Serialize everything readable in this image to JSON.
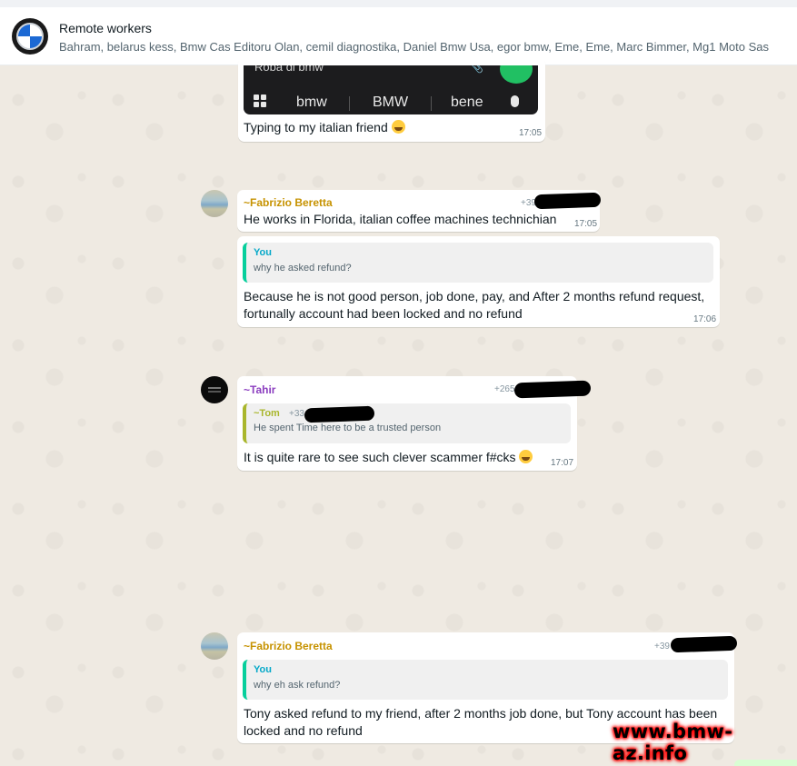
{
  "header": {
    "group_name": "Remote workers",
    "members": "Bahram, belarus kess, Bmw Cas Editoru Olan, cemil diagnostika, Daniel Bmw Usa, egor bmw, Eme, Eme, Marc Bimmer, Mg1 Moto Sas"
  },
  "messages": [
    {
      "keyboard_input": "Roba di bmw",
      "suggestions": [
        "bmw",
        "BMW",
        "bene"
      ],
      "text": "Typing to my italian friend",
      "emoji": "tears-of-joy-emoji",
      "time": "17:05"
    },
    {
      "sender": "~Fabrizio Beretta",
      "sender_color": "#c69200",
      "phone_prefix": "+39",
      "text": "He works in Florida, italian coffee machines technichian",
      "time": "17:05"
    },
    {
      "quote_name": "You",
      "quote_color": "#06cf9c",
      "quote_text": "why he asked refund?",
      "text_line1": "Because he is not good person, job done, pay, and After 2 months refund request,",
      "text_line2": "fortunally account had been locked and no refund",
      "time": "17:06"
    },
    {
      "sender": "~Tahir",
      "sender_color": "#8b3dbf",
      "phone_prefix": "+265",
      "quote_name": "~Tom",
      "quote_color": "#a9b62c",
      "quote_phone": "+33",
      "quote_text": "He spent Time here to be a trusted person",
      "text": "It is quite rare to see such clever scammer f#cks",
      "emoji": "grinning-sweat-emoji",
      "time": "17:07"
    },
    {
      "sender": "~Fabrizio Beretta",
      "sender_color": "#c69200",
      "phone_prefix": "+39",
      "quote_name": "You",
      "quote_text": "why eh ask refund?",
      "text_line1": "Tony asked refund to my friend, after 2 months job done, but Tony account has been",
      "text_line2": "locked and no refund"
    }
  ],
  "watermark": "www.bmw-az.info"
}
